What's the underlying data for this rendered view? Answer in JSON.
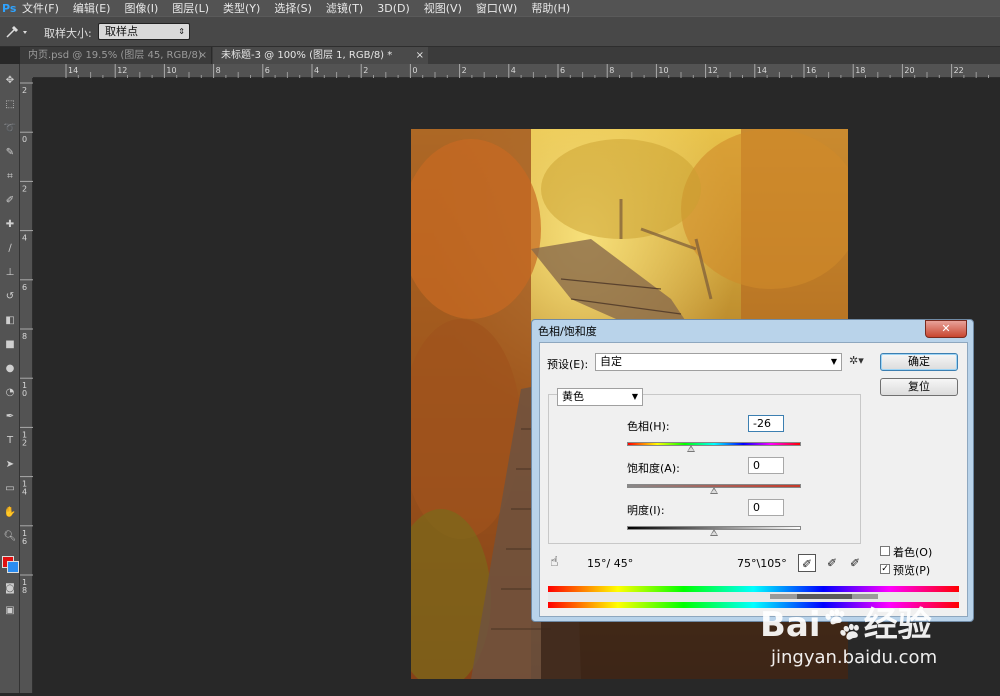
{
  "menubar": {
    "app_icon": "Ps",
    "items": [
      "文件(F)",
      "编辑(E)",
      "图像(I)",
      "图层(L)",
      "类型(Y)",
      "选择(S)",
      "滤镜(T)",
      "3D(D)",
      "视图(V)",
      "窗口(W)",
      "帮助(H)"
    ]
  },
  "options": {
    "sample_label": "取样大小:",
    "sample_value": "取样点"
  },
  "tabs": [
    {
      "label": "内页.psd @ 19.5% (图层 45, RGB/8)",
      "close": "×",
      "active": false
    },
    {
      "label": "未标题-3 @ 100% (图层 1, RGB/8) *",
      "close": "×",
      "active": true
    }
  ],
  "ruler_h": [
    "14",
    "12",
    "10",
    "8",
    "6",
    "4",
    "2",
    "0",
    "2",
    "4",
    "6",
    "8",
    "10",
    "12",
    "14",
    "16",
    "18",
    "20",
    "22"
  ],
  "ruler_v": [
    "2",
    "0",
    "2",
    "4",
    "6",
    "8",
    "1\n0",
    "1\n2",
    "1\n4",
    "1\n6",
    "1\n8"
  ],
  "dialog": {
    "title": "色相/饱和度",
    "close": "✕",
    "preset_label": "预设(E):",
    "preset_value": "自定",
    "ok_label": "确定",
    "reset_label": "复位",
    "channel_value": "黄色",
    "hue_label": "色相(H):",
    "hue_value": "-26",
    "saturation_label": "饱和度(A):",
    "saturation_value": "0",
    "lightness_label": "明度(I):",
    "lightness_value": "0",
    "range_left": "15°/ 45°",
    "range_right": "75°\\105°",
    "colorize_label": "着色(O)",
    "preview_label": "预览(P)",
    "colorize_checked": false,
    "preview_checked": true
  },
  "sliders": {
    "hue_fraction": 0.37,
    "saturation_fraction": 0.5,
    "lightness_fraction": 0.5
  },
  "watermark": {
    "brand": "Bai",
    "brand2": "经验",
    "url": "jingyan.baidu.com"
  }
}
